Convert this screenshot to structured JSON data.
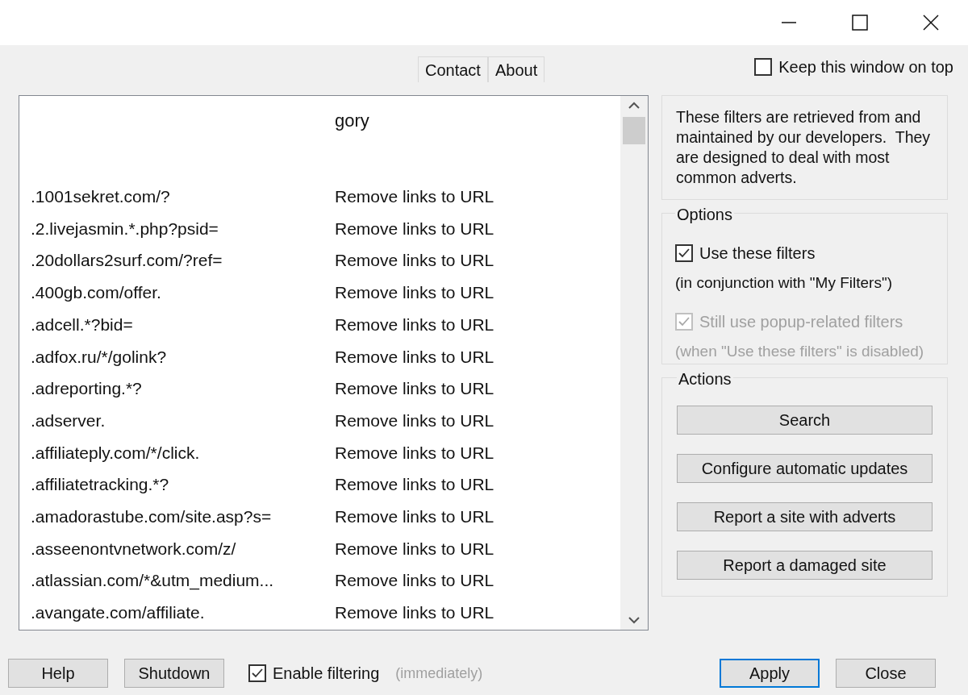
{
  "window": {
    "controls": [
      {
        "kind": "minimize"
      },
      {
        "kind": "maximize"
      },
      {
        "kind": "close"
      }
    ]
  },
  "tabs": [
    {
      "label": "Contact",
      "selected": false
    },
    {
      "label": "About",
      "selected": false
    }
  ],
  "keep_on_top": {
    "label": "Keep this window on top",
    "checked": false
  },
  "table": {
    "columns": [
      "gory"
    ],
    "rows": [
      {
        "filter": ".1001sekret.com/?",
        "category": "Remove links to URL"
      },
      {
        "filter": ".2.livejasmin.*.php?psid=",
        "category": "Remove links to URL"
      },
      {
        "filter": ".20dollars2surf.com/?ref=",
        "category": "Remove links to URL"
      },
      {
        "filter": ".400gb.com/offer.",
        "category": "Remove links to URL"
      },
      {
        "filter": ".adcell.*?bid=",
        "category": "Remove links to URL"
      },
      {
        "filter": ".adfox.ru/*/golink?",
        "category": "Remove links to URL"
      },
      {
        "filter": ".adreporting.*?",
        "category": "Remove links to URL"
      },
      {
        "filter": ".adserver.",
        "category": "Remove links to URL"
      },
      {
        "filter": ".affiliateply.com/*/click.",
        "category": "Remove links to URL"
      },
      {
        "filter": ".affiliatetracking.*?",
        "category": "Remove links to URL"
      },
      {
        "filter": ".amadorastube.com/site.asp?s=",
        "category": "Remove links to URL"
      },
      {
        "filter": ".asseenontvnetwork.com/z/",
        "category": "Remove links to URL"
      },
      {
        "filter": ".atlassian.com/*&utm_medium...",
        "category": "Remove links to URL"
      },
      {
        "filter": ".avangate.com/affiliate.",
        "category": "Remove links to URL"
      }
    ]
  },
  "info": "These filters are retrieved from and maintained by our developers.  They are designed to deal with most common adverts.",
  "options": {
    "title": "Options",
    "items": [
      {
        "label": "Use these filters",
        "note": "(in conjunction with \"My Filters\")",
        "checked": true,
        "disabled": false
      },
      {
        "label": "Still use popup-related filters",
        "note": "(when \"Use these filters\" is disabled)",
        "checked": true,
        "disabled": true
      }
    ]
  },
  "actions": {
    "title": "Actions",
    "buttons": [
      "Search",
      "Configure automatic updates",
      "Report a site with adverts",
      "Report a damaged site"
    ]
  },
  "footer": {
    "left_buttons": [
      "Help",
      "Shutdown"
    ],
    "enable": {
      "label": "Enable filtering",
      "note": "(immediately)",
      "checked": true
    },
    "right_buttons": [
      {
        "label": "Apply",
        "selected": true
      },
      {
        "label": "Close",
        "selected": false
      }
    ]
  }
}
